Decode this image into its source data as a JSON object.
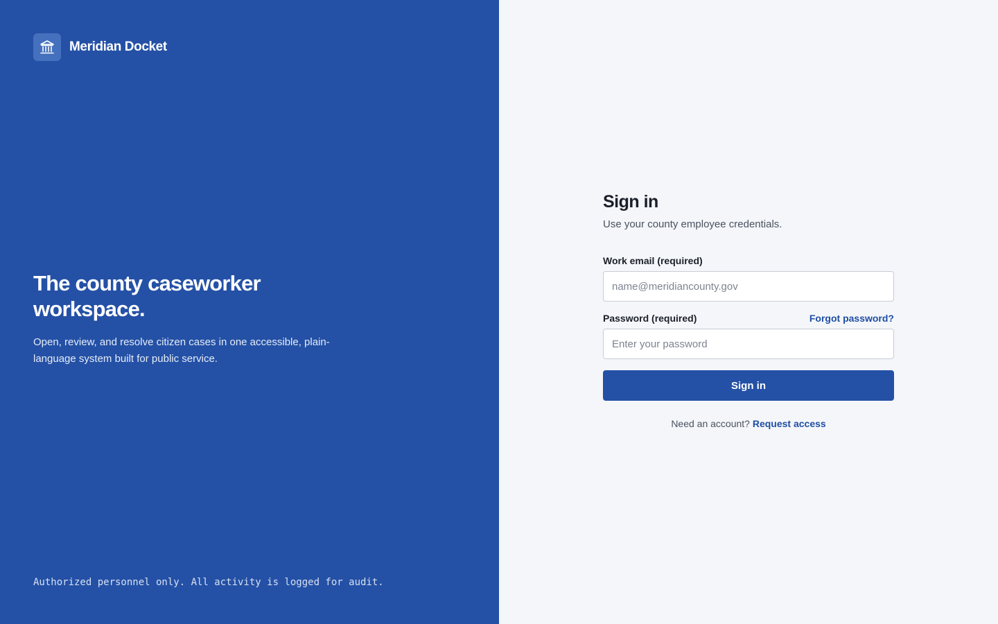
{
  "brand": {
    "name": "Meridian Docket",
    "icon": "courthouse-icon"
  },
  "hero": {
    "title": "The county caseworker workspace.",
    "description": "Open, review, and resolve citizen cases in one accessible, plain-language system built for public service."
  },
  "footer": {
    "notice": "Authorized personnel only. All activity is logged for audit."
  },
  "signin": {
    "title": "Sign in",
    "subtitle": "Use your county employee credentials.",
    "email_label": "Work email (required)",
    "email_placeholder": "name@meridiancounty.gov",
    "email_value": "",
    "password_label": "Password (required)",
    "password_placeholder": "Enter your password",
    "password_value": "",
    "forgot_label": "Forgot password?",
    "submit_label": "Sign in",
    "account_prompt": "Need an account?",
    "request_access_label": "Request access"
  },
  "colors": {
    "brand_blue": "#2451a6",
    "link_blue": "#1f4ea3",
    "page_background": "#f4f6f9"
  }
}
